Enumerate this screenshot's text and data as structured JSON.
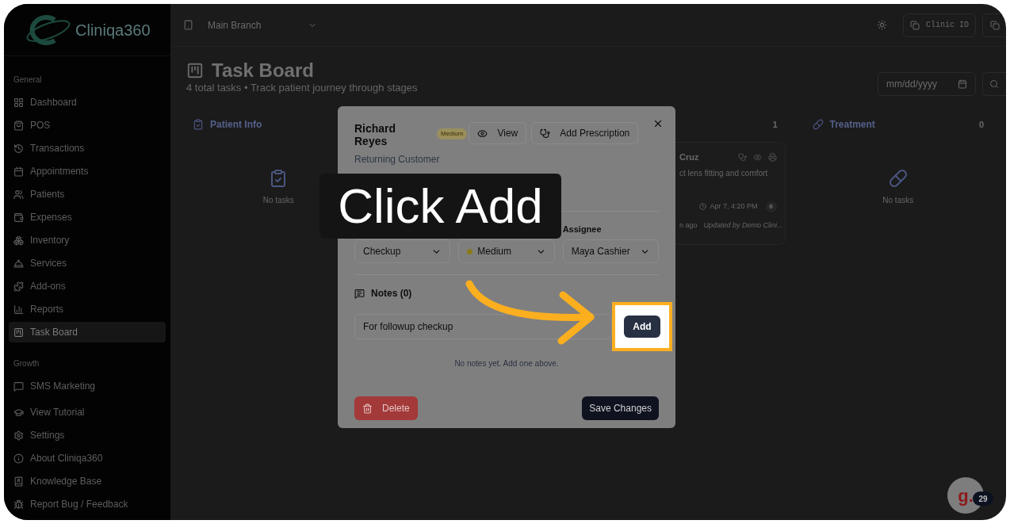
{
  "sidebar": {
    "logo": "Cliniqa360",
    "sections": [
      {
        "title": "General",
        "items": [
          {
            "label": "Dashboard",
            "selected": false
          },
          {
            "label": "POS",
            "selected": false
          },
          {
            "label": "Transactions",
            "selected": false
          },
          {
            "label": "Appointments",
            "selected": false
          },
          {
            "label": "Patients",
            "selected": false
          },
          {
            "label": "Expenses",
            "selected": false
          },
          {
            "label": "Inventory",
            "selected": false
          },
          {
            "label": "Services",
            "selected": false
          },
          {
            "label": "Add-ons",
            "selected": false
          },
          {
            "label": "Reports",
            "selected": false
          },
          {
            "label": "Task Board",
            "selected": true
          }
        ]
      },
      {
        "title": "Growth",
        "items": [
          {
            "label": "SMS Marketing",
            "selected": false
          }
        ]
      }
    ],
    "footer_items": [
      "View Tutorial",
      "Settings",
      "About Cliniqa360",
      "Knowledge Base",
      "Report Bug / Feedback"
    ]
  },
  "topbar": {
    "branch": "Main Branch",
    "clinic_id_button": "Clinic ID"
  },
  "header": {
    "title": "Task Board",
    "subtitle": "4 total tasks • Track patient journey through stages",
    "date_placeholder": "mm/dd/yyyy"
  },
  "columns": [
    {
      "kind": "empty",
      "title": "Patient Info",
      "empty_text": "No tasks"
    },
    {
      "kind": "hidden"
    },
    {
      "kind": "cards",
      "count": "1",
      "card": {
        "name": "Cruz",
        "description": "ct lens fitting and comfort",
        "date": "Apr 7, 4:20 PM",
        "notes_count": "0",
        "age": "n ago",
        "updated_by": "Updated by Demo Clini..."
      }
    },
    {
      "kind": "empty",
      "title": "Treatment",
      "count": "0",
      "empty_text": "No tasks"
    }
  ],
  "modal": {
    "name": "Richard Reyes",
    "priority_badge": "Medium",
    "view_button": "View",
    "prescription_button": "Add Prescription",
    "subtitle": "Returning Customer",
    "fields": [
      {
        "kind": "select",
        "value": "Checkup"
      },
      {
        "kind": "priority",
        "value": "Medium"
      },
      {
        "kind": "select",
        "label": "Assignee",
        "value": "Maya Cashier"
      }
    ],
    "notes_title": "Notes (0)",
    "note_input": "For followup checkup",
    "add_button": "Add",
    "empty_notes": "No notes yet. Add one above.",
    "delete_button": "Delete",
    "save_button": "Save Changes"
  },
  "tutorial": {
    "caption": "Click Add"
  },
  "chat": {
    "logo": "g.",
    "badge": "29"
  }
}
